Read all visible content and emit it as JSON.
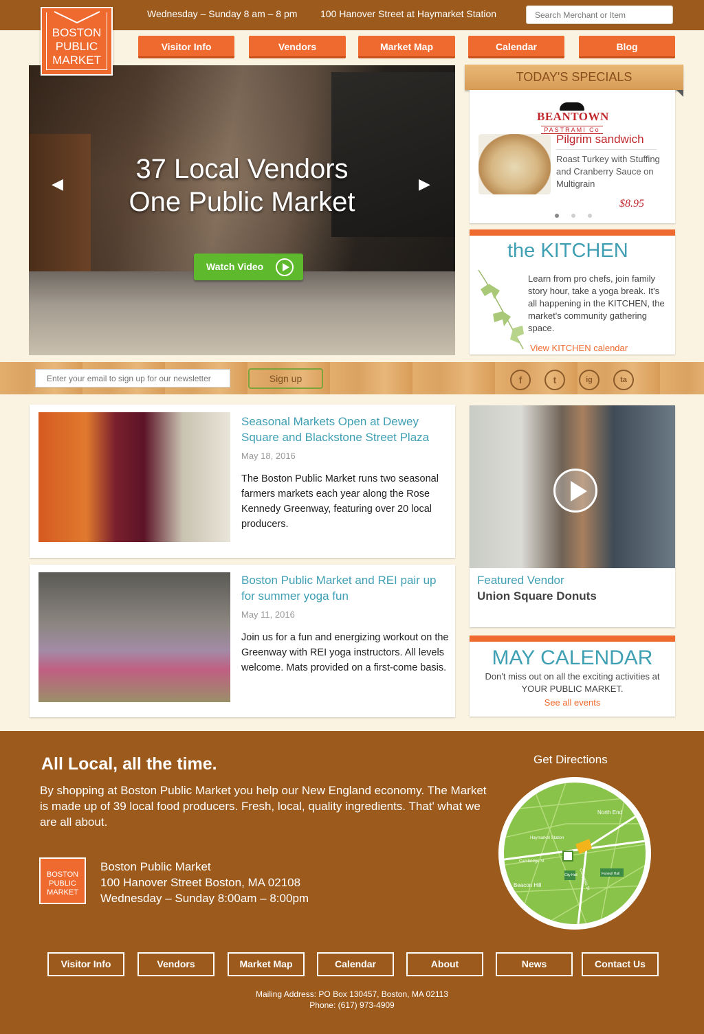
{
  "header": {
    "hours": "Wednesday – Sunday 8 am – 8 pm",
    "address": "100 Hanover Street at Haymarket Station",
    "search_placeholder": "Search Merchant or Item",
    "logo": [
      "BOSTON",
      "PUBLIC",
      "MARKET"
    ]
  },
  "nav": [
    "Visitor Info",
    "Vendors",
    "Market Map",
    "Calendar",
    "Blog"
  ],
  "hero": {
    "line1": "37 Local Vendors",
    "line2": "One Public Market",
    "button": "Watch Video"
  },
  "specials": {
    "banner": "TODAY'S SPECIALS",
    "vendor_name": "BEANTOWN",
    "vendor_sub": "PASTRAMI Co",
    "item": "Pilgrim sandwich",
    "description": "Roast Turkey with Stuffing and Cranberry Sauce on Multigrain",
    "price": "$8.95"
  },
  "kitchen": {
    "title": "the KITCHEN",
    "body": "Learn from pro chefs, join family story hour, take a yoga break. It's all happening in the KITCHEN, the market's community gathering space.",
    "link": "View KITCHEN calendar"
  },
  "newsletter": {
    "placeholder": "Enter your email to sign up for our newsletter",
    "button": "Sign up"
  },
  "social": [
    "f",
    "t",
    "ig",
    "ta"
  ],
  "articles": [
    {
      "title": "Seasonal Markets Open at Dewey Square and Blackstone Street Plaza",
      "date": "May 18, 2016",
      "body": "The Boston Public Market runs two seasonal farmers markets each year along the Rose Kennedy Greenway, featuring over 20 local producers."
    },
    {
      "title": "Boston Public Market and REI pair up for summer yoga fun",
      "date": "May 11, 2016",
      "body": "Join us for a fun and energizing workout on the Greenway with REI yoga instructors. All levels welcome. Mats provided on a first-come basis."
    }
  ],
  "featured": {
    "label": "Featured Vendor",
    "name": "Union Square Donuts"
  },
  "calendar": {
    "title": "MAY CALENDAR",
    "body": "Don't miss out on all the exciting activities at YOUR PUBLIC MARKET.",
    "link": "See all events"
  },
  "footer": {
    "headline": "All Local, all the time.",
    "intro": "By shopping at Boston Public Market you help our New England economy. The Market is made up of 39 local food producers. Fresh, local, quality ingredients. That' what we are all about.",
    "logo": [
      "BOSTON",
      "PUBLIC",
      "MARKET"
    ],
    "name": "Boston Public Market",
    "address": "100 Hanover Street Boston, MA 02108",
    "hours": "Wednesday – Sunday  8:00am – 8:00pm",
    "directions": "Get Directions",
    "map_labels": [
      "North End",
      "Haymarket Station",
      "Cambridge St",
      "Beacon Hill",
      "City Hall",
      "Congress St",
      "Faneuil Hall"
    ],
    "nav": [
      "Visitor Info",
      "Vendors",
      "Market Map",
      "Calendar",
      "About",
      "News",
      "Contact Us"
    ],
    "mailing": "Mailing Address: PO Box 130457, Boston, MA 02113",
    "phone": "Phone: (617) 973-4909"
  },
  "colors": {
    "brown": "#9c5a1c",
    "orange": "#ef6a2f",
    "teal": "#3f9fb3",
    "green": "#5fb92d",
    "red": "#c0272d"
  }
}
